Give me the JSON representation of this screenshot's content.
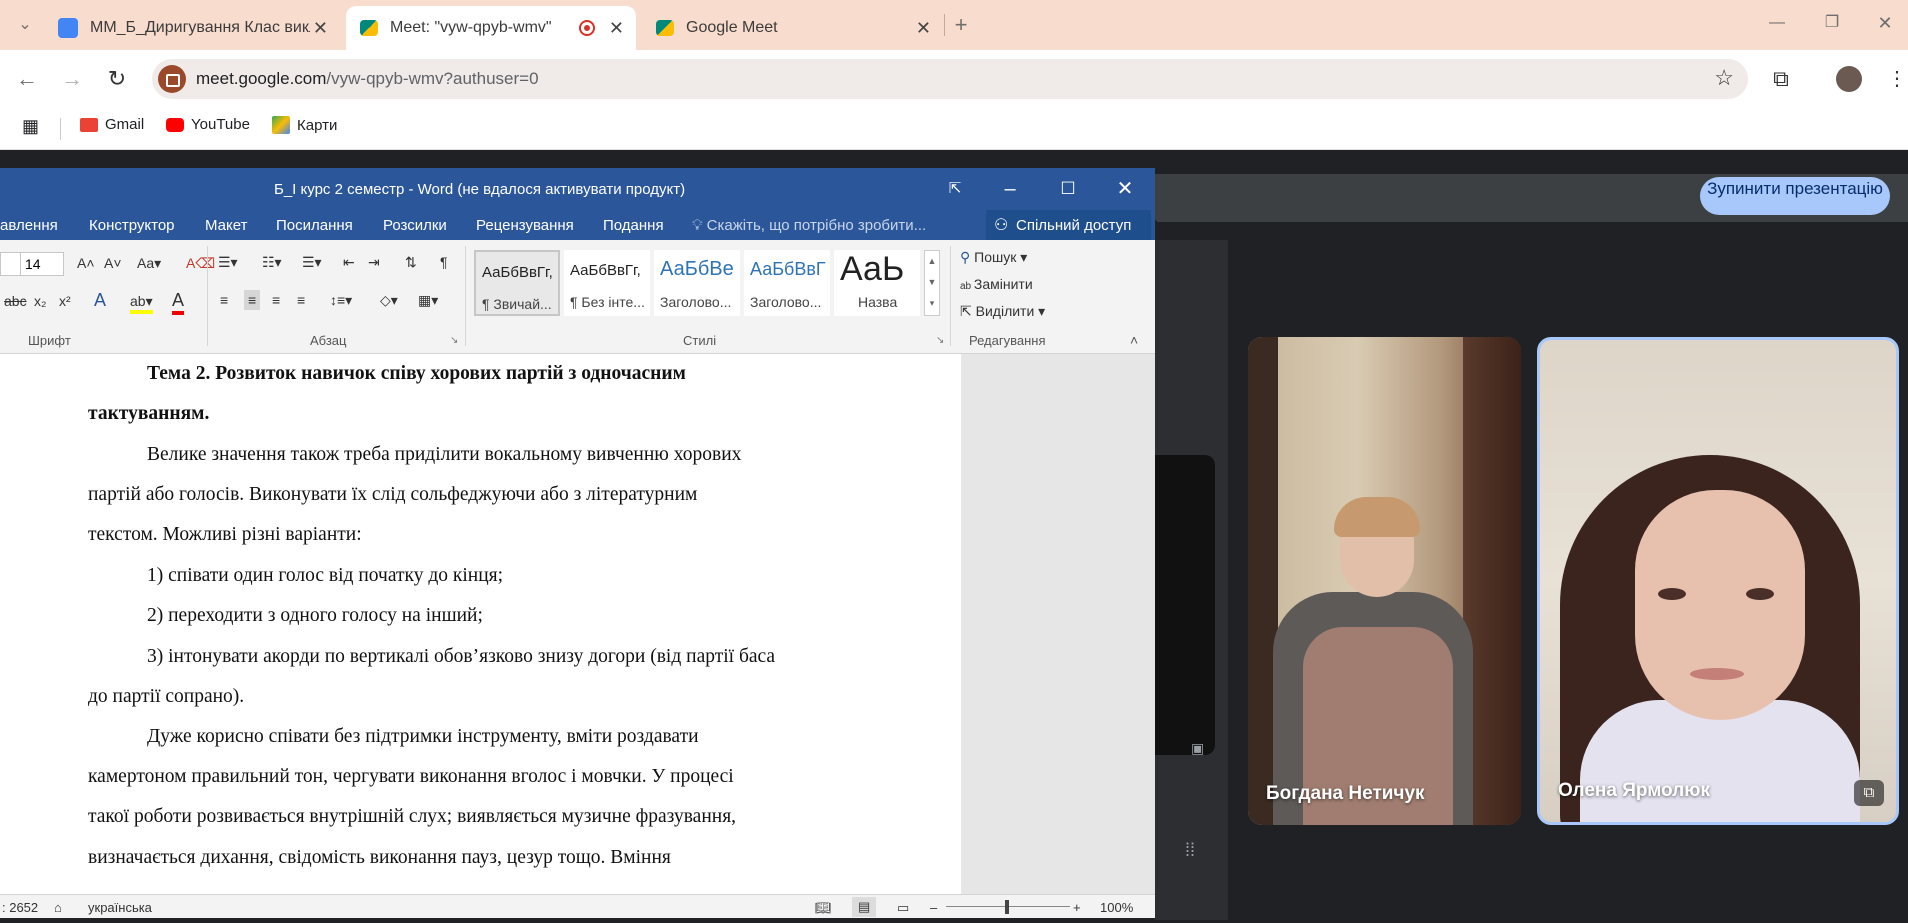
{
  "browser": {
    "tabs": [
      {
        "title": "ММ_Б_Диригування Клас викл",
        "icon": "google-classroom-icon",
        "color": "#4285f4",
        "active": false
      },
      {
        "title": "Meet: \"vyw-qpyb-wmv\"",
        "icon": "google-meet-icon",
        "color": "#00897b",
        "active": true,
        "recording": true
      },
      {
        "title": "Google Meet",
        "icon": "google-meet-icon",
        "color": "#00897b",
        "active": false
      }
    ],
    "new_tab": "+",
    "url_host": "meet.google.com",
    "url_path": "/vyw-qpyb-wmv?authuser=0",
    "bookmarks": [
      {
        "label": "Gmail",
        "icon": "gmail-icon",
        "color": "#ea4335"
      },
      {
        "label": "YouTube",
        "icon": "youtube-icon",
        "color": "#ff0000"
      },
      {
        "label": "Карти",
        "icon": "maps-icon",
        "color": "#34a853"
      }
    ]
  },
  "meet": {
    "stop_presenting": "Зупинити презентацію",
    "participants": [
      {
        "name": "Богдана Нетичук"
      },
      {
        "name": "Олена Ярмолюк"
      }
    ],
    "accent": "#a8c7fa"
  },
  "word": {
    "title": "Б_І курс 2 семестр - Word (не вдалося активувати продукт)",
    "menu": [
      "авлення",
      "Конструктор",
      "Макет",
      "Посилання",
      "Розсилки",
      "Рецензування",
      "Подання"
    ],
    "tell_me": "Скажіть, що потрібно зробити...",
    "share": "Спільний доступ",
    "font_size": "14",
    "groups": {
      "font": "Шрифт",
      "paragraph": "Абзац",
      "styles": "Стилі",
      "editing": "Редагування"
    },
    "styles": [
      {
        "preview": "АаБбВвГг,",
        "name": "¶ Звичай..."
      },
      {
        "preview": "АаБбВвГг,",
        "name": "¶ Без інте..."
      },
      {
        "preview": "АаБбВе",
        "name": "Заголово..."
      },
      {
        "preview": "АаБбВвГ",
        "name": "Заголово..."
      },
      {
        "preview": "АаЬ",
        "name": "Назва"
      }
    ],
    "editing": {
      "find": "Пошук",
      "replace": "Замінити",
      "select": "Виділити"
    },
    "document": {
      "heading_line1": "Тема 2. Розвиток навичок співу хорових партій з одночасним",
      "heading_line2": "тактуванням.",
      "p1_l1": "Велике значення також треба приділити вокальному вивченню хорових",
      "p1_l2": "партій або голосів. Виконувати їх слід сольфеджуючи або з літературним",
      "p1_l3": "текстом. Можливі різні варіанти:",
      "li1": "1) співати один голос від початку до кінця;",
      "li2": "2) переходити з одного голосу на інший;",
      "li3_l1": "3) інтонувати акорди по вертикалі обов’язково знизу догори (від партії баса",
      "li3_l2": "до партії сопрано).",
      "p2_l1": "Дуже корисно співати без підтримки інструменту, вміти роздавати",
      "p2_l2": "камертоном правильний тон, чергувати виконання вголос і мовчки. У процесі",
      "p2_l3": "такої роботи розвивається внутрішній слух; виявляється музичне фразування,",
      "p2_l4": "визначається дихання, свідомість виконання пауз, цезур тощо. Вміння"
    },
    "status": {
      "words": ": 2652",
      "language": "українська",
      "zoom": "100%"
    },
    "brand_color": "#2b579a"
  }
}
